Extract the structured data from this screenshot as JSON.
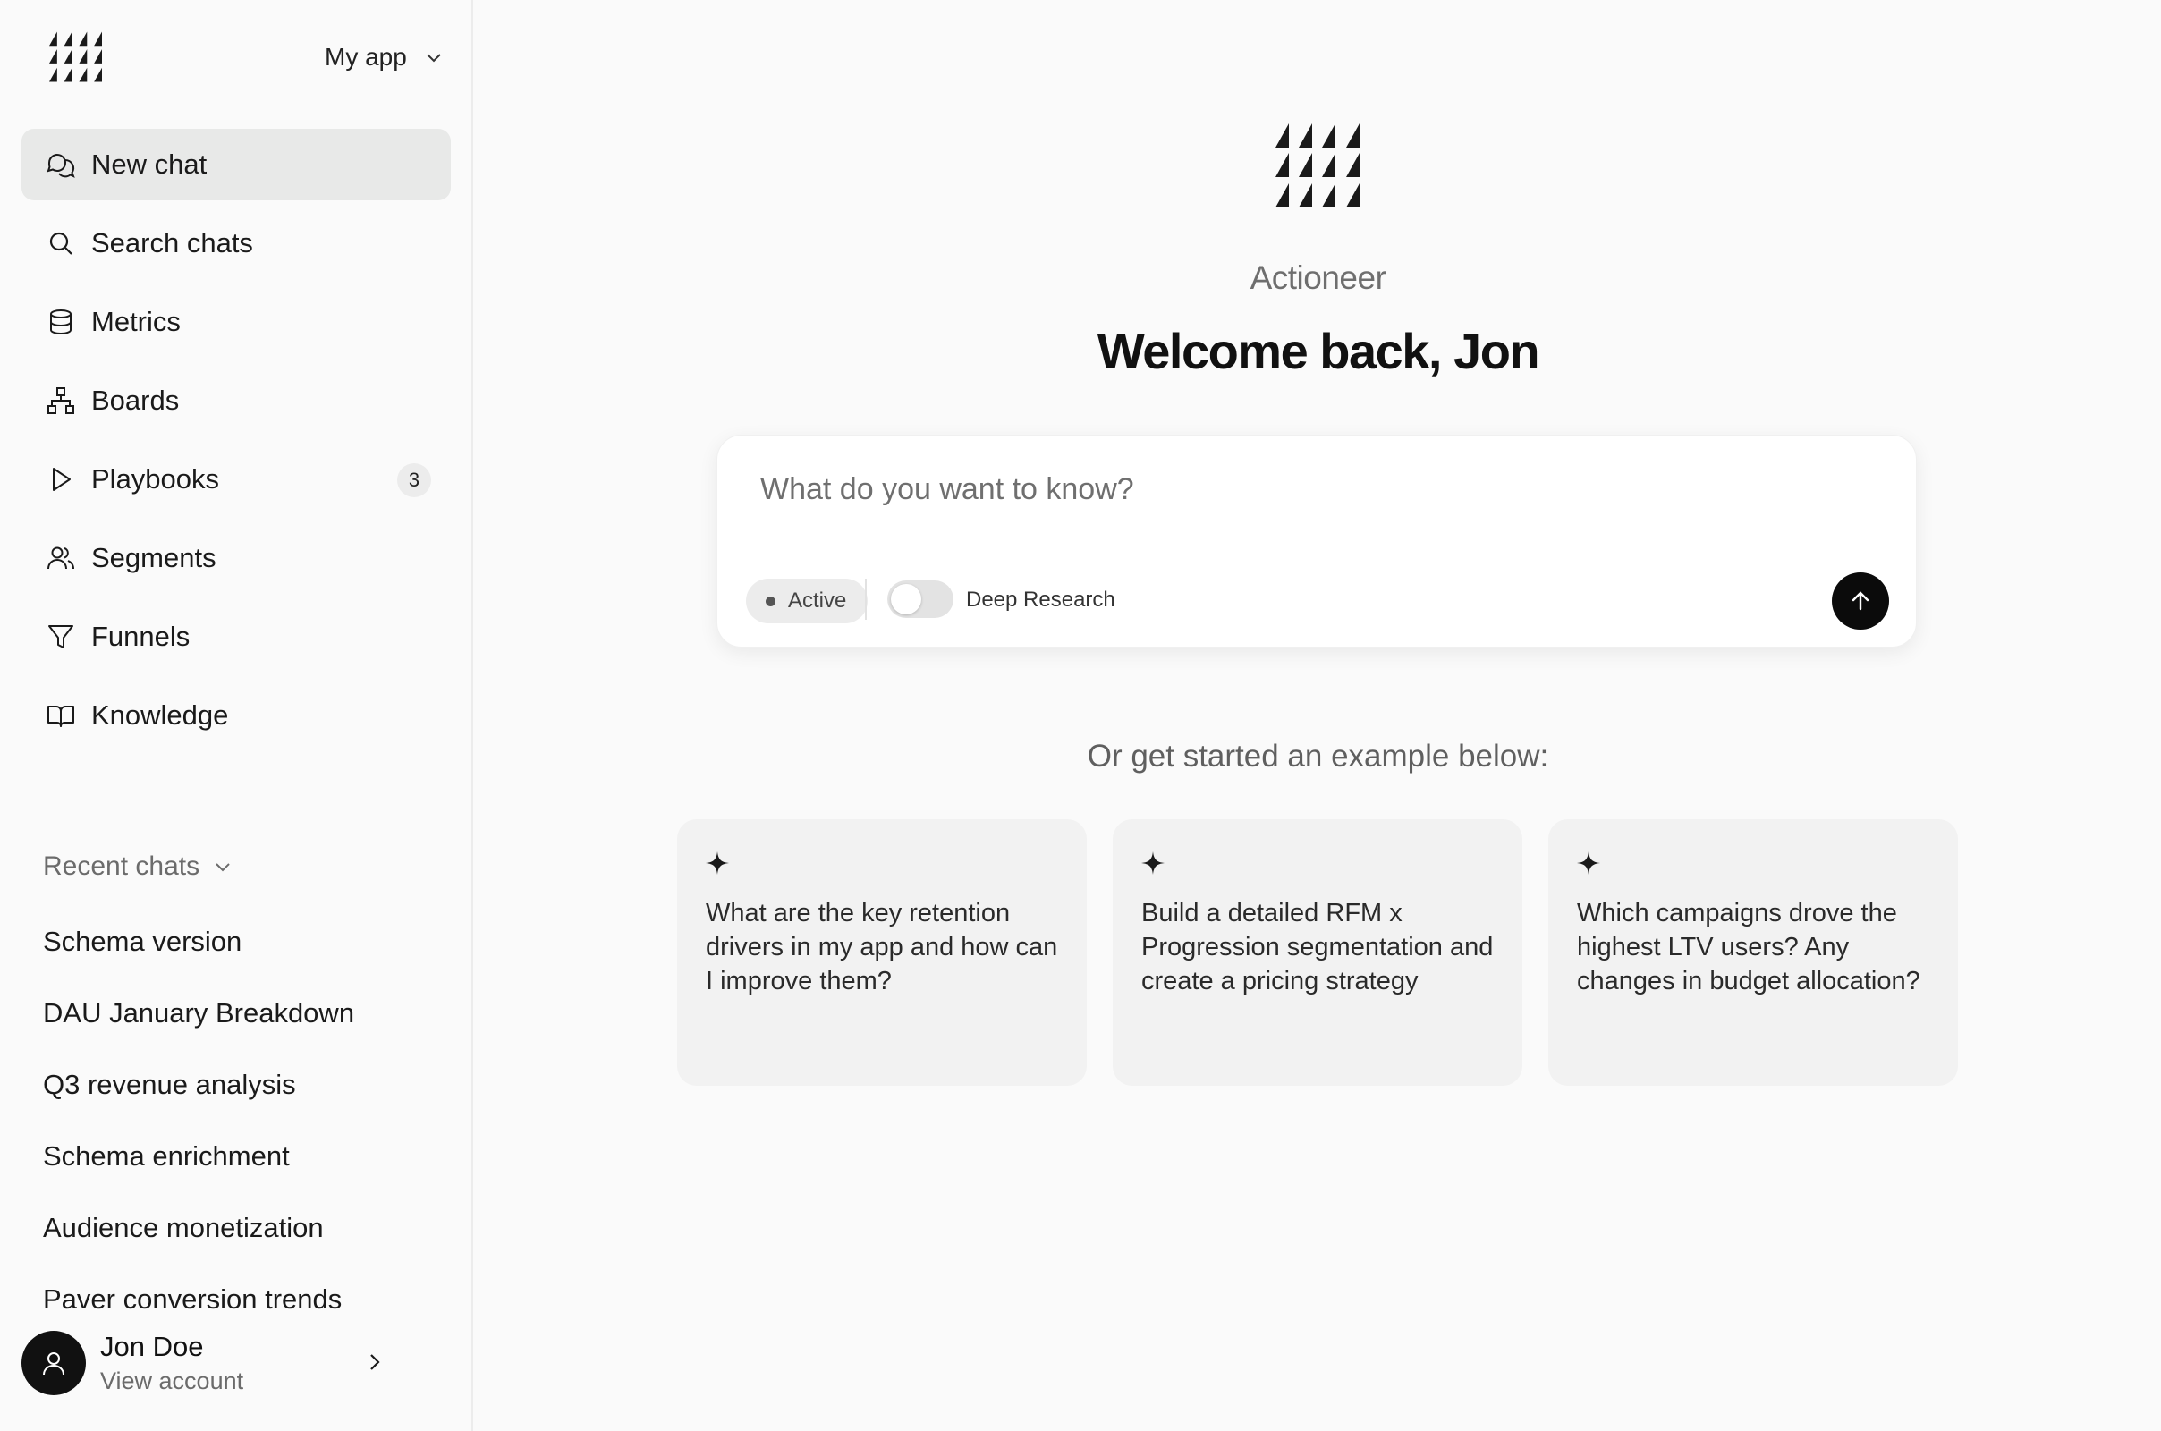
{
  "sidebar": {
    "app_switcher": "My app",
    "nav": [
      {
        "label": "New chat",
        "icon": "chat-bubbles-icon"
      },
      {
        "label": "Search chats",
        "icon": "search-icon"
      },
      {
        "label": "Metrics",
        "icon": "database-icon"
      },
      {
        "label": "Boards",
        "icon": "hierarchy-icon"
      },
      {
        "label": "Playbooks",
        "icon": "play-icon",
        "badge": "3"
      },
      {
        "label": "Segments",
        "icon": "users-icon"
      },
      {
        "label": "Funnels",
        "icon": "funnel-icon"
      },
      {
        "label": "Knowledge",
        "icon": "book-icon"
      }
    ],
    "recent_heading": "Recent chats",
    "recent": [
      "Schema version",
      "DAU January Breakdown",
      "Q3 revenue analysis",
      "Schema enrichment",
      "Audience monetization",
      "Paver conversion trends"
    ],
    "account": {
      "name": "Jon Doe",
      "subtitle": "View account"
    }
  },
  "main": {
    "brand": "Actioneer",
    "welcome": "Welcome back, Jon",
    "composer": {
      "placeholder": "What do you want to know?",
      "status_chip": "Active",
      "toggle_label": "Deep Research",
      "deep_research_on": false
    },
    "examples_heading": "Or get started an example below:",
    "examples": [
      "What are the key retention drivers in my app and how can I improve them?",
      "Build a detailed RFM x Progression segmentation and create a pricing strategy",
      "Which campaigns drove the highest LTV users? Any changes in budget allocation?"
    ]
  },
  "colors": {
    "accent": "#0b0b0b",
    "active_nav_bg": "#e8e9e8",
    "card_bg": "#f2f2f2"
  }
}
